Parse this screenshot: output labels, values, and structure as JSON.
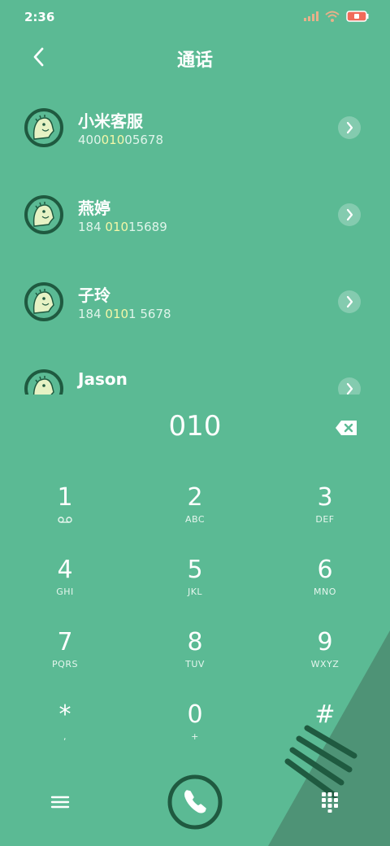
{
  "status": {
    "time": "2:36"
  },
  "header": {
    "title": "通话"
  },
  "contacts": [
    {
      "name": "小米客服",
      "num_pre": "400",
      "num_hl": "010",
      "num_post": "05678"
    },
    {
      "name": "燕婷",
      "num_pre": "184 ",
      "num_hl": "010",
      "num_post": "15689"
    },
    {
      "name": "子玲",
      "num_pre": "184 ",
      "num_hl": "010",
      "num_post": "1 5678"
    },
    {
      "name": "Jason",
      "num_pre": "",
      "num_hl": "",
      "num_post": ""
    }
  ],
  "dialer": {
    "input": "010"
  },
  "keys": [
    {
      "digit": "1",
      "letters": ""
    },
    {
      "digit": "2",
      "letters": "ABC"
    },
    {
      "digit": "3",
      "letters": "DEF"
    },
    {
      "digit": "4",
      "letters": "GHI"
    },
    {
      "digit": "5",
      "letters": "JKL"
    },
    {
      "digit": "6",
      "letters": "MNO"
    },
    {
      "digit": "7",
      "letters": "PQRS"
    },
    {
      "digit": "8",
      "letters": "TUV"
    },
    {
      "digit": "9",
      "letters": "WXYZ"
    },
    {
      "digit": "*",
      "letters": ","
    },
    {
      "digit": "0",
      "letters": "+"
    },
    {
      "digit": "#",
      "letters": ""
    }
  ],
  "icons": {
    "back": "chevron-left-icon",
    "chevron": "chevron-right-icon",
    "backspace": "backspace-icon",
    "voicemail": "voicemail-icon",
    "menu": "menu-icon",
    "call": "phone-icon",
    "keypad": "dialpad-icon"
  },
  "colors": {
    "background": "#5bba94",
    "dark_accent": "#1f5a40",
    "highlight": "#f4f7a8",
    "shadow_triangle": "#4e9376"
  }
}
